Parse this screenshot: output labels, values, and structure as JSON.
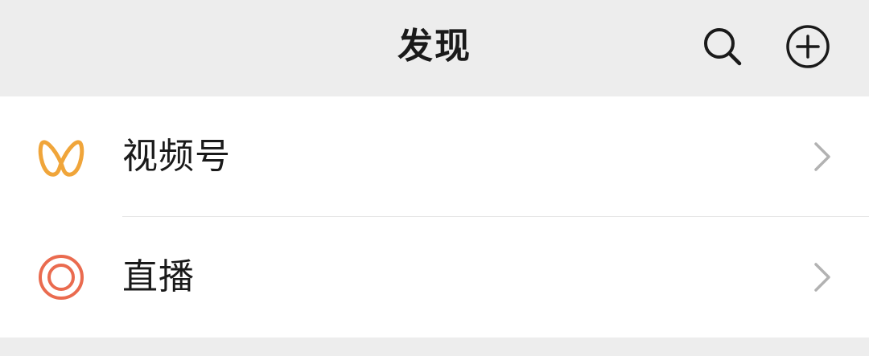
{
  "header": {
    "title": "发现",
    "search_icon": "search-icon",
    "add_icon": "plus-circle-icon"
  },
  "items": [
    {
      "label": "视频号",
      "icon": "channels-icon",
      "icon_color": "#f0a53a"
    },
    {
      "label": "直播",
      "icon": "live-icon",
      "icon_color": "#ea6b4f"
    }
  ],
  "colors": {
    "background": "#ededed",
    "surface": "#ffffff",
    "text": "#1a1a1a",
    "chevron": "#b2b2b2",
    "divider": "#e5e5e5"
  }
}
